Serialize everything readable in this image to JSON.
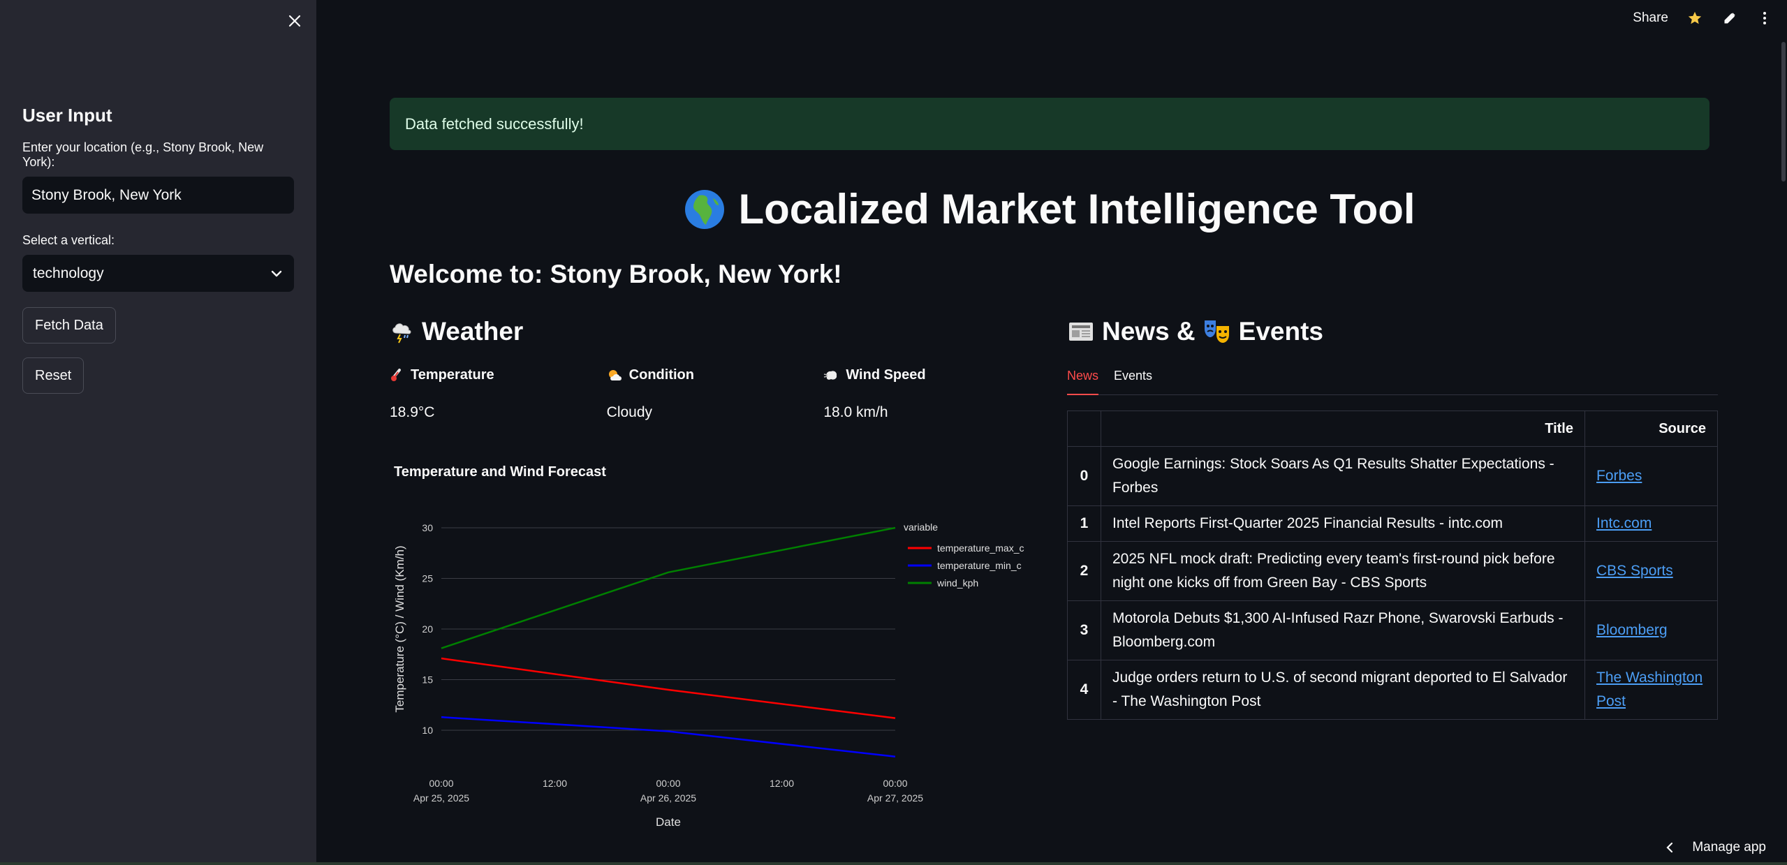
{
  "sidebar": {
    "heading": "User Input",
    "location_label": "Enter your location (e.g., Stony Brook, New York):",
    "location_value": "Stony Brook, New York",
    "vertical_label": "Select a vertical:",
    "vertical_value": "technology",
    "fetch_button": "Fetch Data",
    "reset_button": "Reset"
  },
  "topbar": {
    "share": "Share"
  },
  "alert": "Data fetched successfully!",
  "title": "Localized Market Intelligence Tool",
  "welcome": "Welcome to: Stony Brook, New York!",
  "weather": {
    "heading": "Weather",
    "temperature_label": "Temperature",
    "temperature_value": "18.9°C",
    "condition_label": "Condition",
    "condition_value": "Cloudy",
    "wind_label": "Wind Speed",
    "wind_value": "18.0 km/h"
  },
  "news": {
    "heading_part1": "News &",
    "heading_part2": "Events",
    "tabs": [
      "News",
      "Events"
    ],
    "columns": [
      "",
      "Title",
      "Source"
    ],
    "rows": [
      {
        "idx": "0",
        "title": "Google Earnings: Stock Soars As Q1 Results Shatter Expectations - Forbes",
        "source": "Forbes"
      },
      {
        "idx": "1",
        "title": "Intel Reports First-Quarter 2025 Financial Results - intc.com",
        "source": "Intc.com"
      },
      {
        "idx": "2",
        "title": "2025 NFL mock draft: Predicting every team's first-round pick before night one kicks off from Green Bay - CBS Sports",
        "source": "CBS Sports"
      },
      {
        "idx": "3",
        "title": "Motorola Debuts $1,300 AI-Infused Razr Phone, Swarovski Earbuds - Bloomberg.com",
        "source": "Bloomberg"
      },
      {
        "idx": "4",
        "title": "Judge orders return to U.S. of second migrant deported to El Salvador - The Washington Post",
        "source": "The Washington Post"
      }
    ]
  },
  "manage_app": "Manage app",
  "chart_data": {
    "type": "line",
    "title": "Temperature and Wind Forecast",
    "xlabel": "Date",
    "ylabel": "Temperature (°C) / Wind (Km/h)",
    "x": [
      "2025-04-25",
      "2025-04-26",
      "2025-04-27"
    ],
    "x_ticks": [
      {
        "line1": "00:00",
        "line2": "Apr 25, 2025"
      },
      {
        "line1": "12:00",
        "line2": ""
      },
      {
        "line1": "00:00",
        "line2": "Apr 26, 2025"
      },
      {
        "line1": "12:00",
        "line2": ""
      },
      {
        "line1": "00:00",
        "line2": "Apr 27, 2025"
      }
    ],
    "y_ticks": [
      10,
      15,
      20,
      25,
      30
    ],
    "ylim": [
      7.2,
      30
    ],
    "grid": true,
    "legend_title": "variable",
    "legend_position": "top-right",
    "series": [
      {
        "name": "temperature_max_c",
        "color": "#ff0000",
        "values": [
          17.1,
          14.0,
          11.2
        ]
      },
      {
        "name": "temperature_min_c",
        "color": "#0000ff",
        "values": [
          11.3,
          9.9,
          7.4
        ]
      },
      {
        "name": "wind_kph",
        "color": "#008000",
        "values": [
          18.1,
          25.6,
          30.0
        ]
      }
    ]
  }
}
